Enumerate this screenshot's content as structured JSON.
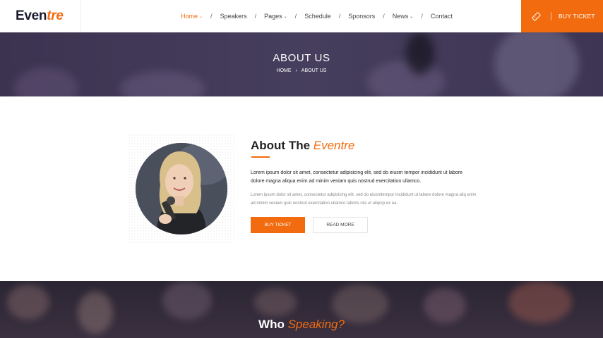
{
  "header": {
    "logo_part1": "Even",
    "logo_part2": "tre",
    "nav": [
      {
        "label": "Home",
        "caret": "⌄",
        "active": true
      },
      {
        "label": "Speakers"
      },
      {
        "label": "Pages",
        "caret": "⌄"
      },
      {
        "label": "Schedule"
      },
      {
        "label": "Sponsors"
      },
      {
        "label": "News",
        "caret": "⌄"
      },
      {
        "label": "Contact"
      }
    ],
    "separator": "/",
    "ticket_icon": "ticket-icon",
    "ticket_label": "BUY TICKET"
  },
  "banner": {
    "title": "ABOUT US",
    "breadcrumb_home": "HOME",
    "breadcrumb_sep": "›",
    "breadcrumb_current": "ABOUT US"
  },
  "about": {
    "title_main": "About The ",
    "title_accent": "Eventre",
    "lead": "Lorem ipsum dolor sit amet, consectetur adipisicing elit, sed do eiusm tempor incididunt ut labore dolore magna aliqua enim ad minim veniam quis nostrud exercitation ullamco.",
    "body": "Lorem ipsum dolor sit amet, consectetur adipisicing elit, sed do eiusmtempor incididunt ut labore dolore magna aliq enim ad minim veniam quis nostrud exercitation ullamco laboris nisi ut aliquip ex ea.",
    "buy_button": "BUY TICKET",
    "read_more_button": "READ MORE",
    "image_icon": "speaker-photo"
  },
  "speaking": {
    "title_main": "Who ",
    "title_accent": "Speaking?"
  },
  "colors": {
    "accent": "#f26b0f",
    "dark_text": "#222222",
    "banner_bg": "#463e5d"
  }
}
